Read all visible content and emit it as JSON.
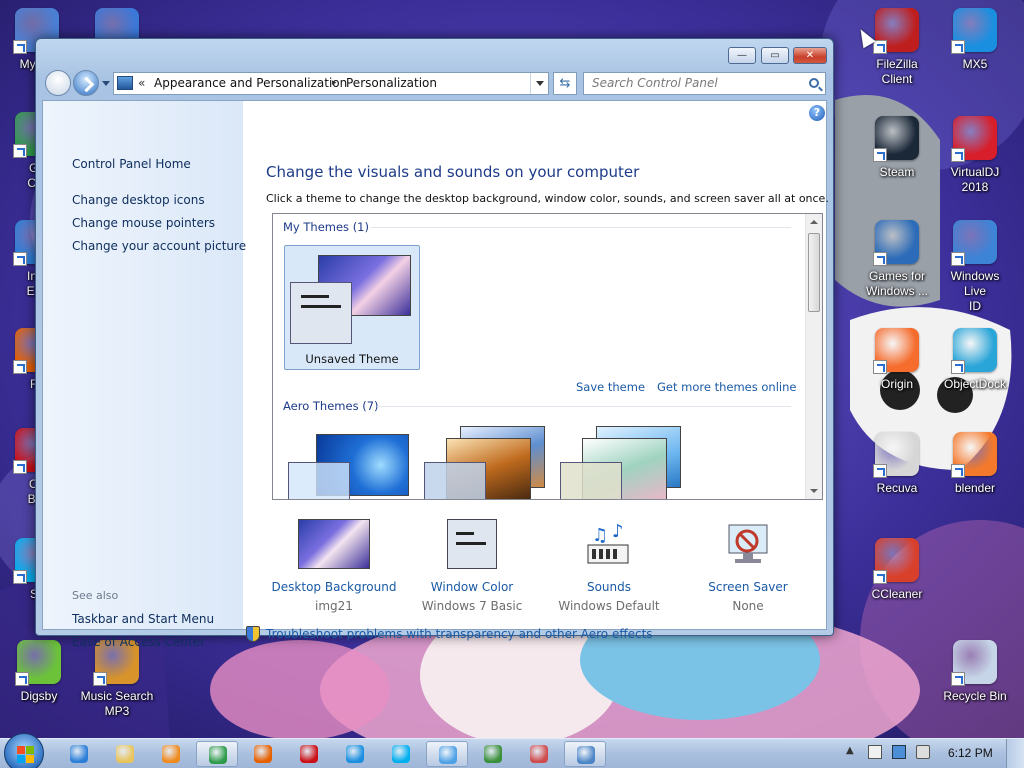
{
  "desktop": {
    "icons_left": [
      {
        "label": "My Co",
        "name": "desktop-icon-my-computer",
        "color": "#4a7fd4"
      },
      {
        "label": "",
        "name": "desktop-icon-blue-ball",
        "color": "#3b78d8"
      },
      {
        "label": "Go\nChr",
        "name": "desktop-icon-google-chrome",
        "color": "#2e9b4a"
      },
      {
        "label": "Inte\nExp",
        "name": "desktop-icon-internet-explorer",
        "color": "#2b7fd8"
      },
      {
        "label": "Fir",
        "name": "desktop-icon-firefox",
        "color": "#e66000"
      },
      {
        "label": "Op\nBro",
        "name": "desktop-icon-opera",
        "color": "#cc0f16"
      },
      {
        "label": "Sk",
        "name": "desktop-icon-skype",
        "color": "#00aff0"
      },
      {
        "label": "Digsby",
        "name": "desktop-icon-digsby",
        "color": "#6cc33a"
      },
      {
        "label": "Music Search\nMP3",
        "name": "desktop-icon-music-search-mp3",
        "color": "#d8932a"
      }
    ],
    "icons_right": [
      {
        "label": "FileZilla Client",
        "name": "desktop-icon-filezilla",
        "color": "#bf1e1e"
      },
      {
        "label": "MX5",
        "name": "desktop-icon-mx5",
        "color": "#1a8fe0"
      },
      {
        "label": "Steam",
        "name": "desktop-icon-steam",
        "color": "#1b2838"
      },
      {
        "label": "VirtualDJ 2018",
        "name": "desktop-icon-virtualdj",
        "color": "#d81e2a"
      },
      {
        "label": "Games for\nWindows ...",
        "name": "desktop-icon-games-for-windows",
        "color": "#2c6bb8"
      },
      {
        "label": "Windows Live\nID",
        "name": "desktop-icon-windows-live-id",
        "color": "#3d83d6"
      },
      {
        "label": "Origin",
        "name": "desktop-icon-origin",
        "color": "#f56c2d"
      },
      {
        "label": "ObjectDock",
        "name": "desktop-icon-objectdock",
        "color": "#2aa5d8"
      },
      {
        "label": "Recuva",
        "name": "desktop-icon-recuva",
        "color": "#d6d6d6"
      },
      {
        "label": "blender",
        "name": "desktop-icon-blender",
        "color": "#f5792a"
      },
      {
        "label": "CCleaner",
        "name": "desktop-icon-ccleaner",
        "color": "#d9402b"
      },
      {
        "label": "Recycle Bin",
        "name": "desktop-icon-recycle-bin",
        "color": "#c6d6e8"
      }
    ]
  },
  "window": {
    "caption_buttons": {
      "minimize": "—",
      "maximize": "▭",
      "close": "✕"
    },
    "address": {
      "chevron": "«",
      "segment1": "Appearance and Personalization",
      "separator": "▸",
      "segment2": "Personalization"
    },
    "refresh_glyph": "⇆",
    "search_placeholder": "Search Control Panel",
    "help_glyph": "?",
    "sidebar": {
      "home": "Control Panel Home",
      "links": [
        "Change desktop icons",
        "Change mouse pointers",
        "Change your account picture"
      ],
      "see_also_title": "See also",
      "see_also": [
        "Taskbar and Start Menu",
        "Ease of Access Center"
      ]
    },
    "main": {
      "heading": "Change the visuals and sounds on your computer",
      "subheading": "Click a theme to change the desktop background, window color, sounds, and screen saver all at once.",
      "my_themes_group": "My Themes (1)",
      "selected_theme": "Unsaved Theme",
      "save_theme": "Save theme",
      "get_more": "Get more themes online",
      "aero_group": "Aero Themes (7)",
      "settings": [
        {
          "name": "Desktop Background",
          "value": "img21"
        },
        {
          "name": "Window Color",
          "value": "Windows 7 Basic"
        },
        {
          "name": "Sounds",
          "value": "Windows Default"
        },
        {
          "name": "Screen Saver",
          "value": "None"
        }
      ],
      "troubleshoot": "Troubleshoot problems with transparency and other Aero effects"
    }
  },
  "taskbar": {
    "items": [
      {
        "name": "taskbar-internet-explorer",
        "color": "#2b7fd8",
        "running": false
      },
      {
        "name": "taskbar-windows-explorer",
        "color": "#e8c45a",
        "running": false
      },
      {
        "name": "taskbar-media-player",
        "color": "#f08a1d",
        "running": false
      },
      {
        "name": "taskbar-chrome",
        "color": "#2e9b4a",
        "running": true
      },
      {
        "name": "taskbar-firefox",
        "color": "#e66000",
        "running": false
      },
      {
        "name": "taskbar-opera",
        "color": "#cc0f16",
        "running": false
      },
      {
        "name": "taskbar-mx5",
        "color": "#1a8fe0",
        "running": false
      },
      {
        "name": "taskbar-skype",
        "color": "#00aff0",
        "running": false
      },
      {
        "name": "taskbar-control-panel",
        "color": "#4ea1e6",
        "running": true
      },
      {
        "name": "taskbar-app-checkmark",
        "color": "#3a8f3a",
        "running": false
      },
      {
        "name": "taskbar-app-recorder",
        "color": "#cf4b4b",
        "running": false
      },
      {
        "name": "taskbar-app-monitor",
        "color": "#4c86c7",
        "running": true
      }
    ],
    "tray_arrow": "▲",
    "clock": "6:12 PM"
  }
}
